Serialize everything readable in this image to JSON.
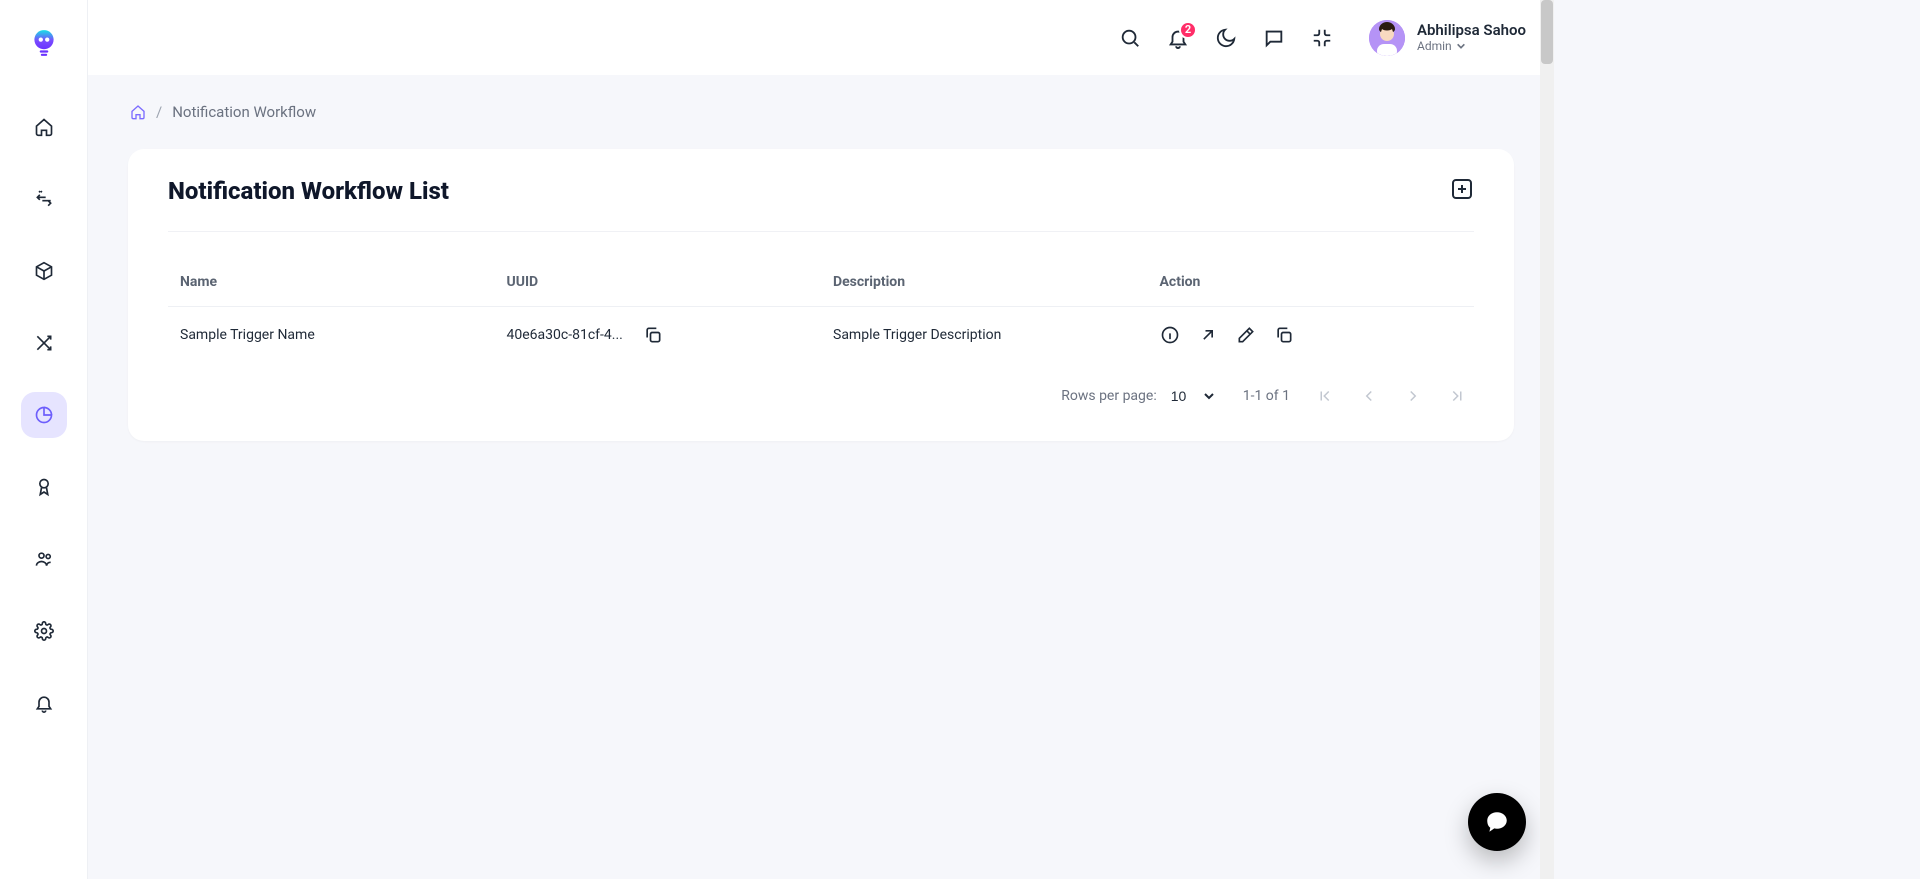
{
  "header": {
    "notification_count": "2",
    "user_name": "Abhilipsa Sahoo",
    "user_role": "Admin"
  },
  "breadcrumb": {
    "current": "Notification Workflow"
  },
  "card": {
    "title": "Notification Workflow List"
  },
  "table": {
    "columns": {
      "name": "Name",
      "uuid": "UUID",
      "description": "Description",
      "action": "Action"
    },
    "rows": [
      {
        "name": "Sample Trigger Name",
        "uuid": "40e6a30c-81cf-4...",
        "description": "Sample Trigger Description"
      }
    ]
  },
  "paging": {
    "label": "Rows per page:",
    "page_size": "10",
    "range": "1-1 of 1"
  }
}
